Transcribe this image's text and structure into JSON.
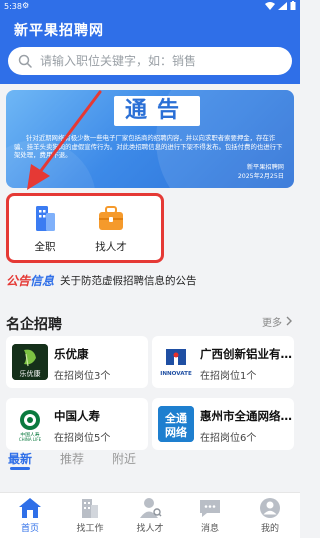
{
  "status_bar": {
    "time": "5:38"
  },
  "app": {
    "title": "新平果招聘网"
  },
  "search": {
    "placeholder": "请输入职位关键字，如：销售"
  },
  "banner": {
    "title": "通告",
    "body": "针对近期网络有极少数一些电子厂家包括商的招聘内容，并以向求职者索要押金，存在诈骗、挂羊头卖狗肉的虚假宣传行为。对此类招聘信息的进行下架不得发布。包括付费的也进行下架处理，费用不退。",
    "signer": "新平果招聘网",
    "date": "2025年2月25日"
  },
  "quick_entries": [
    {
      "label": "全职",
      "icon": "building-icon"
    },
    {
      "label": "找人才",
      "icon": "briefcase-icon"
    }
  ],
  "notice": {
    "tag_part1": "公告",
    "tag_part2": "信息",
    "text": "关于防范虚假招聘信息的公告"
  },
  "companies_section": {
    "title": "名企招聘",
    "more_label": "更多",
    "companies": [
      {
        "name": "乐优康",
        "jobs": "在招岗位3个",
        "logo": "leyoukang-logo"
      },
      {
        "name": "广西创新铝业有...",
        "jobs": "在招岗位1个",
        "logo": "innovate-logo"
      },
      {
        "name": "中国人寿",
        "jobs": "在招岗位5个",
        "logo": "china-life-logo"
      },
      {
        "name": "惠州市全通网络...",
        "jobs": "在招岗位6个",
        "logo": "quantong-logo"
      }
    ],
    "logo_texts": {
      "leyoukang": "乐优康",
      "innovate": "INNOVATE",
      "china_life_cn": "中国人寿",
      "china_life_en": "CHINA LIFE",
      "quantong_1": "全通",
      "quantong_2": "网络"
    }
  },
  "tabs": [
    "最新",
    "推荐",
    "附近"
  ],
  "bottom_nav": [
    {
      "label": "首页",
      "icon": "home-icon",
      "active": true
    },
    {
      "label": "找工作",
      "icon": "building-icon",
      "active": false
    },
    {
      "label": "找人才",
      "icon": "person-icon",
      "active": false
    },
    {
      "label": "消息",
      "icon": "message-icon",
      "active": false
    },
    {
      "label": "我的",
      "icon": "profile-icon",
      "active": false
    }
  ],
  "colors": {
    "primary": "#2f6fe8",
    "annotation_red": "#e53935",
    "quick_icon_blue": "#3b7cf2",
    "quick_icon_orange": "#f59a2c"
  }
}
